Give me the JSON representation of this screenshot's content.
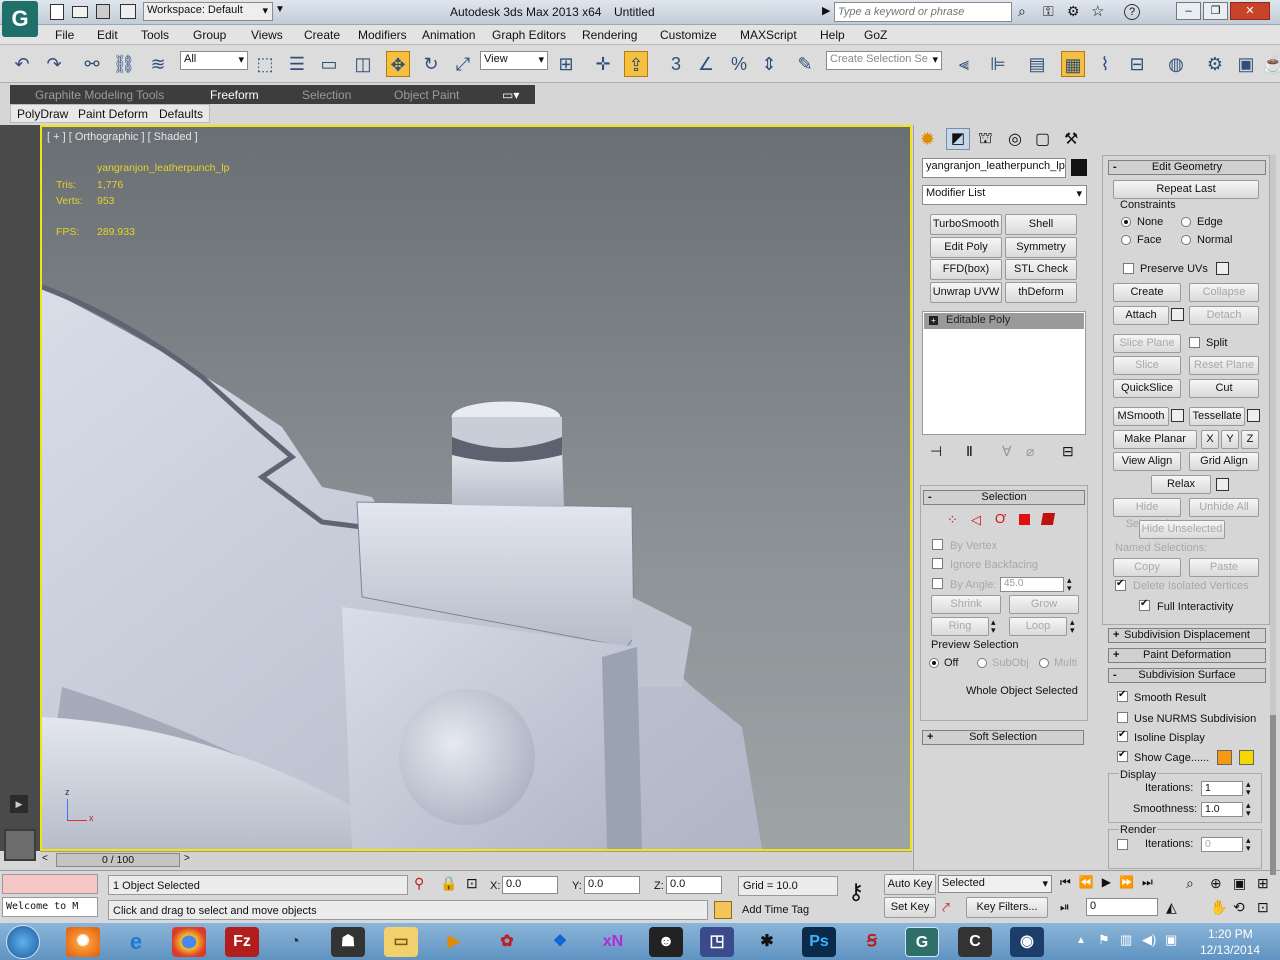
{
  "title": {
    "workspace": "Workspace: Default",
    "app": "Autodesk 3ds Max  2013 x64",
    "file": "Untitled",
    "search_placeholder": "Type a keyword or phrase"
  },
  "menu": [
    "File",
    "Edit",
    "Tools",
    "Group",
    "Views",
    "Create",
    "Modifiers",
    "Animation",
    "Graph Editors",
    "Rendering",
    "Customize",
    "MAXScript",
    "Help",
    "GoZ"
  ],
  "toolbar": {
    "filter": "All",
    "ref_coord": "View",
    "selection_set": "Create Selection Se"
  },
  "ribbon": {
    "tabs": [
      "Graphite Modeling Tools",
      "Freeform",
      "Selection",
      "Object Paint"
    ],
    "subtabs": [
      "PolyDraw",
      "Paint Deform",
      "Defaults"
    ]
  },
  "viewport": {
    "label": "[ + ] [ Orthographic ] [ Shaded ]",
    "object_name": "yangranjon_leatherpunch_lp",
    "tris_label": "Tris:",
    "tris": "1,776",
    "verts_label": "Verts:",
    "verts": "953",
    "fps_label": "FPS:",
    "fps": "289.933",
    "axis_z": "z",
    "axis_x": "x"
  },
  "timeline": {
    "frame": "0 / 100"
  },
  "status": {
    "selected": "1 Object Selected",
    "prompt": "Click and drag to select and move objects",
    "x_label": "X:",
    "x": "0.0",
    "y_label": "Y:",
    "y": "0.0",
    "z_label": "Z:",
    "z": "0.0",
    "grid": "Grid = 10.0",
    "add_time_tag": "Add Time Tag",
    "auto_key": "Auto Key",
    "set_key": "Set Key",
    "key_mode": "Selected",
    "key_filters": "Key Filters...",
    "current_frame": "0",
    "maxscript": "Welcome to M"
  },
  "command_panel": {
    "object_name": "yangranjon_leatherpunch_lp",
    "modifier_list": "Modifier List",
    "modifier_buttons": [
      "TurboSmooth",
      "Shell",
      "Edit Poly",
      "Symmetry",
      "FFD(box)",
      "STL Check",
      "Unwrap UVW",
      "thDeform (WSI"
    ],
    "stack_item": "Editable Poly"
  },
  "selection_rollout": {
    "title": "Selection",
    "by_vertex": "By Vertex",
    "ignore_backfacing": "Ignore Backfacing",
    "by_angle": "By Angle:",
    "angle": "45.0",
    "shrink": "Shrink",
    "grow": "Grow",
    "ring": "Ring",
    "loop": "Loop",
    "preview_selection": "Preview Selection",
    "off": "Off",
    "subobj": "SubObj",
    "multi": "Multi",
    "status": "Whole Object Selected",
    "soft_selection": "Soft Selection"
  },
  "edit_geometry": {
    "title": "Edit Geometry",
    "repeat_last": "Repeat Last",
    "constraints": "Constraints",
    "none": "None",
    "edge": "Edge",
    "face": "Face",
    "normal": "Normal",
    "preserve_uvs": "Preserve UVs",
    "create": "Create",
    "collapse": "Collapse",
    "attach": "Attach",
    "detach": "Detach",
    "slice_plane": "Slice Plane",
    "split": "Split",
    "slice": "Slice",
    "reset_plane": "Reset Plane",
    "quickslice": "QuickSlice",
    "cut": "Cut",
    "msmooth": "MSmooth",
    "tessellate": "Tessellate",
    "make_planar": "Make Planar",
    "x": "X",
    "y": "Y",
    "z": "Z",
    "view_align": "View Align",
    "grid_align": "Grid Align",
    "relax": "Relax",
    "hide_selected": "Hide Selected",
    "unhide_all": "Unhide All",
    "hide_unselected": "Hide Unselected",
    "named_selections": "Named Selections:",
    "copy": "Copy",
    "paste": "Paste",
    "delete_isolated": "Delete Isolated Vertices",
    "full_interactivity": "Full Interactivity"
  },
  "rollouts": [
    "Subdivision Displacement",
    "Paint Deformation",
    "Subdivision Surface"
  ],
  "subdivision_surface": {
    "smooth_result": "Smooth Result",
    "use_nurms": "Use NURMS Subdivision",
    "isoline_display": "Isoline Display",
    "show_cage": "Show Cage......",
    "cage_color_1": "#f59a10",
    "cage_color_2": "#f5d800",
    "display": "Display",
    "iterations_label": "Iterations:",
    "iterations": "1",
    "smoothness_label": "Smoothness:",
    "smoothness": "1.0",
    "render": "Render",
    "render_iterations": "0"
  },
  "taskbar": {
    "time": "1:20 PM",
    "date": "12/13/2014"
  }
}
